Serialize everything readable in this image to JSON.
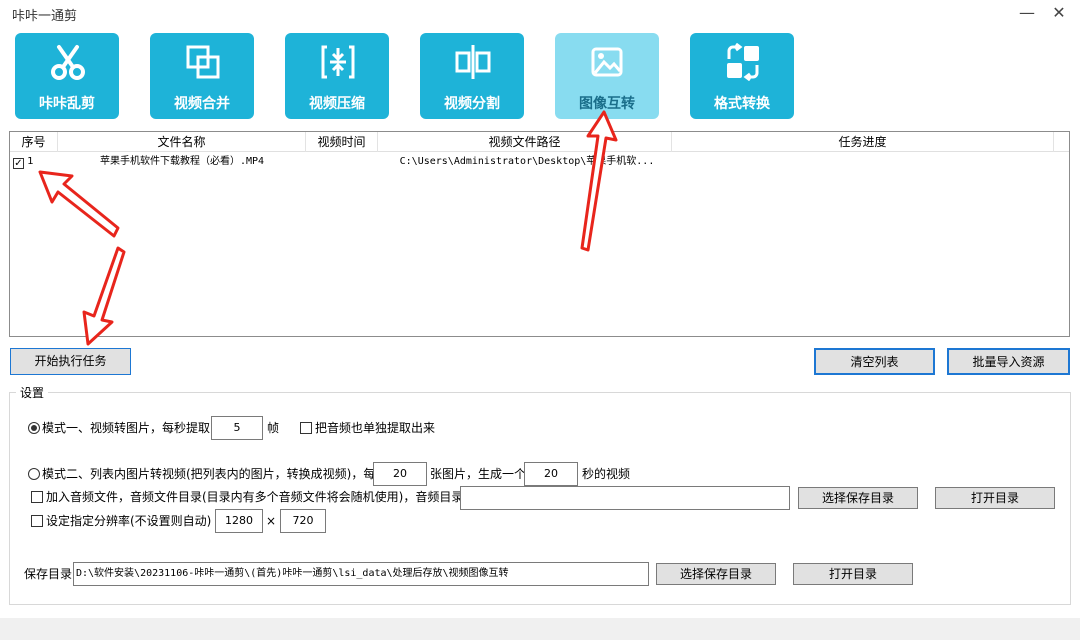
{
  "window": {
    "title": "咔咔一通剪",
    "minimize": "—",
    "close": "✕"
  },
  "toolbar": [
    {
      "label": "咔咔乱剪",
      "icon": "scissors-icon"
    },
    {
      "label": "视频合并",
      "icon": "merge-icon"
    },
    {
      "label": "视频压缩",
      "icon": "compress-icon"
    },
    {
      "label": "视频分割",
      "icon": "split-icon"
    },
    {
      "label": "图像互转",
      "icon": "image-convert-icon",
      "active": true
    },
    {
      "label": "格式转换",
      "icon": "format-convert-icon"
    }
  ],
  "table": {
    "headers": [
      "序号",
      "文件名称",
      "视频时间",
      "视频文件路径",
      "任务进度"
    ],
    "rows": [
      {
        "checked": true,
        "index": "1",
        "name": "苹果手机软件下载教程（必看）.MP4",
        "duration": "",
        "path": "C:\\Users\\Administrator\\Desktop\\苹果手机软...",
        "progress": ""
      }
    ]
  },
  "actions": {
    "start": "开始执行任务",
    "clear": "清空列表",
    "import": "批量导入资源"
  },
  "settings": {
    "legend": "设置",
    "mode1": {
      "label": "模式一、视频转图片，每秒提取",
      "value": "5",
      "unit": "帧",
      "selected": true,
      "audio_label": "把音频也单独提取出来"
    },
    "mode2": {
      "label": "模式二、列表内图片转视频(把列表内的图片，转换成视频)，每",
      "images": "20",
      "mid": "张图片，生成一个",
      "seconds": "20",
      "tail": "秒的视频",
      "selected": false
    },
    "audio": {
      "label": "加入音频文件，音频文件目录(目录内有多个音频文件将会随机使用)，音频目录",
      "value": "",
      "choose": "选择保存目录",
      "open": "打开目录"
    },
    "resolution": {
      "label": "设定指定分辨率(不设置则自动)",
      "width": "1280",
      "times": "×",
      "height": "720"
    },
    "save": {
      "label": "保存目录",
      "value": "D:\\软件安装\\20231106-咔咔一通剪\\(首先)咔咔一通剪\\lsi_data\\处理后存放\\视频图像互转",
      "choose": "选择保存目录",
      "open": "打开目录"
    }
  },
  "colors": {
    "toolbar_bg": "#1eb3d8",
    "toolbar_active": "#88dcf0",
    "arrow": "#e8251c",
    "button_border": "#1d77d3"
  }
}
